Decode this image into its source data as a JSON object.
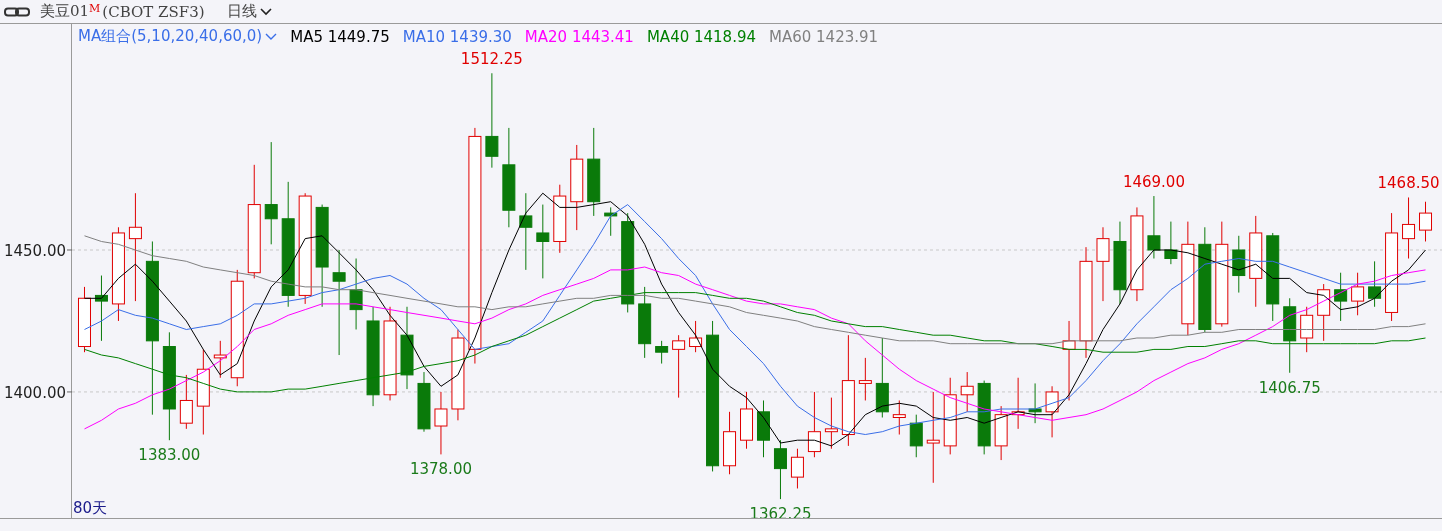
{
  "header": {
    "badge": "M",
    "code": "(CBOT ZSF3)",
    "period": "日线"
  },
  "legend": {
    "title": "MA组合(5,10,20,40,60,0)",
    "items": [
      {
        "value": "1449.75"
      },
      {
        "value": "1439.30"
      },
      {
        "value": "1443.41"
      },
      {
        "value": "1418.94"
      },
      {
        "value": "1423.91"
      }
    ]
  },
  "chart_data": {
    "type": "candlestick",
    "ylim": [
      1355.6,
      1529.6
    ],
    "yticks": [
      {
        "value": 1450,
        "label": "1450.00"
      },
      {
        "value": 1400,
        "label": "1400.00"
      }
    ],
    "series": [
      {
        "name": "美豆01",
        "ohlc": [
          [
            1416,
            1437,
            1414,
            1433
          ],
          [
            1434,
            1441,
            1418,
            1432
          ],
          [
            1431,
            1458,
            1425,
            1456
          ],
          [
            1454,
            1470,
            1432,
            1458
          ],
          [
            1446,
            1453,
            1392,
            1418
          ],
          [
            1416,
            1421,
            1383,
            1394
          ],
          [
            1389,
            1406,
            1387,
            1397
          ],
          [
            1395,
            1415,
            1385,
            1408
          ],
          [
            1412,
            1418,
            1405,
            1413
          ],
          [
            1405,
            1443,
            1402,
            1439
          ],
          [
            1442,
            1480,
            1440,
            1466
          ],
          [
            1466,
            1488,
            1452,
            1461
          ],
          [
            1461,
            1474,
            1430,
            1434
          ],
          [
            1434,
            1470,
            1431,
            1469
          ],
          [
            1465,
            1466,
            1430,
            1444
          ],
          [
            1442,
            1450,
            1413,
            1439
          ],
          [
            1436,
            1447,
            1422,
            1429
          ],
          [
            1425,
            1430,
            1395,
            1399
          ],
          [
            1399,
            1430,
            1397,
            1425
          ],
          [
            1420,
            1430,
            1401,
            1406
          ],
          [
            1403,
            1407,
            1386,
            1387
          ],
          [
            1388,
            1400,
            1378,
            1394
          ],
          [
            1394,
            1422,
            1390,
            1419
          ],
          [
            1415,
            1493,
            1410,
            1490
          ],
          [
            1490,
            1512.25,
            1479,
            1483
          ],
          [
            1480,
            1493,
            1458,
            1464
          ],
          [
            1462,
            1470,
            1443,
            1458
          ],
          [
            1456,
            1466,
            1440,
            1453
          ],
          [
            1453,
            1473,
            1449,
            1469
          ],
          [
            1467,
            1487,
            1457,
            1482
          ],
          [
            1482,
            1493,
            1462,
            1467
          ],
          [
            1463,
            1465,
            1455,
            1462
          ],
          [
            1460,
            1463,
            1428,
            1431
          ],
          [
            1431,
            1437,
            1412,
            1417
          ],
          [
            1416,
            1418,
            1410,
            1414
          ],
          [
            1415,
            1420,
            1398,
            1418
          ],
          [
            1416,
            1425,
            1414,
            1419
          ],
          [
            1420,
            1425,
            1372,
            1374
          ],
          [
            1374,
            1393,
            1371,
            1386
          ],
          [
            1383,
            1400,
            1380,
            1394
          ],
          [
            1393,
            1397,
            1377,
            1383
          ],
          [
            1380,
            1383,
            1362.25,
            1373
          ],
          [
            1370,
            1380,
            1366,
            1377
          ],
          [
            1379,
            1400,
            1377,
            1386
          ],
          [
            1386,
            1398,
            1380,
            1387
          ],
          [
            1385,
            1420,
            1381,
            1404
          ],
          [
            1403,
            1412,
            1397,
            1404
          ],
          [
            1403,
            1419,
            1391,
            1393
          ],
          [
            1391,
            1397,
            1385,
            1392
          ],
          [
            1389,
            1392,
            1377,
            1381
          ],
          [
            1382,
            1400,
            1368,
            1383
          ],
          [
            1381,
            1405,
            1378,
            1399
          ],
          [
            1399,
            1407,
            1393,
            1402
          ],
          [
            1403,
            1404,
            1378,
            1381
          ],
          [
            1381,
            1395,
            1376,
            1392
          ],
          [
            1392,
            1405,
            1387,
            1393
          ],
          [
            1394,
            1403,
            1389,
            1393
          ],
          [
            1393,
            1402,
            1384,
            1400
          ],
          [
            1415,
            1425,
            1397,
            1418
          ],
          [
            1418,
            1451,
            1412,
            1446
          ],
          [
            1446,
            1458,
            1432,
            1454
          ],
          [
            1453,
            1460,
            1431,
            1436
          ],
          [
            1436,
            1465,
            1432,
            1462
          ],
          [
            1455,
            1469,
            1447,
            1450
          ],
          [
            1450,
            1460,
            1445,
            1447
          ],
          [
            1424,
            1460,
            1420,
            1452
          ],
          [
            1452,
            1458,
            1421,
            1422
          ],
          [
            1424,
            1460,
            1423,
            1452
          ],
          [
            1450,
            1455,
            1435,
            1441
          ],
          [
            1440,
            1462,
            1430,
            1456
          ],
          [
            1455,
            1456,
            1425,
            1431
          ],
          [
            1430,
            1433,
            1406.75,
            1418
          ],
          [
            1419,
            1430,
            1414,
            1427
          ],
          [
            1427,
            1438,
            1418,
            1436
          ],
          [
            1436,
            1442,
            1425,
            1432
          ],
          [
            1432,
            1442,
            1427,
            1437
          ],
          [
            1437,
            1446,
            1430,
            1433
          ],
          [
            1428,
            1463,
            1425,
            1456
          ],
          [
            1454,
            1468.5,
            1447,
            1459
          ],
          [
            1457,
            1467,
            1453,
            1463
          ]
        ]
      },
      {
        "name": "MA5",
        "type": "line",
        "color": "#000000",
        "values": [
          1433,
          1433,
          1440,
          1445,
          1439,
          1432,
          1425,
          1415,
          1406,
          1410,
          1425,
          1437,
          1443,
          1454,
          1455,
          1449,
          1443,
          1436,
          1427,
          1420,
          1409,
          1402,
          1406,
          1419,
          1435,
          1450,
          1463,
          1470,
          1465,
          1465,
          1466,
          1467,
          1462,
          1452,
          1438,
          1428,
          1420,
          1408,
          1402,
          1398,
          1391,
          1382,
          1383,
          1383,
          1381,
          1385,
          1392,
          1395,
          1396,
          1395,
          1391,
          1390,
          1391,
          1389,
          1391,
          1393,
          1392,
          1392,
          1399,
          1410,
          1422,
          1431,
          1443,
          1450,
          1450,
          1449,
          1447,
          1445,
          1443,
          1445,
          1440,
          1440,
          1435,
          1434,
          1429,
          1430,
          1433,
          1439,
          1443,
          1450
        ]
      },
      {
        "name": "MA10",
        "type": "line",
        "color": "#3a6ee8",
        "values": [
          1422,
          1425,
          1429,
          1427,
          1426,
          1424,
          1422,
          1423,
          1424,
          1427,
          1431,
          1431,
          1432,
          1433,
          1435,
          1436,
          1438,
          1440,
          1441,
          1438,
          1433,
          1429,
          1422,
          1415,
          1416,
          1417,
          1421,
          1425,
          1434,
          1443,
          1452,
          1462,
          1466,
          1460,
          1454,
          1447,
          1441,
          1431,
          1422,
          1416,
          1410,
          1402,
          1395,
          1391,
          1388,
          1386,
          1385,
          1386,
          1388,
          1389,
          1390,
          1391,
          1393,
          1393,
          1394,
          1394,
          1394,
          1396,
          1398,
          1404,
          1411,
          1417,
          1424,
          1430,
          1436,
          1440,
          1445,
          1446,
          1447,
          1446,
          1446,
          1444,
          1442,
          1440,
          1438,
          1438,
          1438,
          1438,
          1438,
          1439
        ]
      },
      {
        "name": "MA20",
        "type": "line",
        "color": "#ff00ff",
        "values": [
          1387,
          1390,
          1394,
          1396,
          1399,
          1401,
          1404,
          1407,
          1411,
          1416,
          1422,
          1424,
          1427,
          1429,
          1431,
          1431,
          1431,
          1430,
          1429,
          1428,
          1427,
          1426,
          1425,
          1424,
          1426,
          1429,
          1431,
          1434,
          1436,
          1438,
          1440,
          1443,
          1443,
          1444,
          1442,
          1441,
          1438,
          1436,
          1434,
          1432,
          1431,
          1431,
          1430,
          1429,
          1426,
          1424,
          1418,
          1413,
          1408,
          1404,
          1401,
          1398,
          1396,
          1394,
          1393,
          1392,
          1391,
          1390,
          1391,
          1392,
          1394,
          1397,
          1400,
          1404,
          1407,
          1410,
          1412,
          1415,
          1417,
          1420,
          1423,
          1427,
          1429,
          1432,
          1435,
          1438,
          1439,
          1441,
          1442,
          1443
        ]
      },
      {
        "name": "MA40",
        "type": "line",
        "color": "#008000",
        "values": [
          1415,
          1413,
          1412,
          1410,
          1408,
          1406,
          1405,
          1403,
          1401,
          1400,
          1400,
          1400,
          1401,
          1401,
          1402,
          1403,
          1404,
          1405,
          1406,
          1407,
          1409,
          1410,
          1411,
          1413,
          1416,
          1418,
          1420,
          1423,
          1426,
          1429,
          1432,
          1433,
          1434,
          1435,
          1435,
          1435,
          1435,
          1434,
          1433,
          1433,
          1432,
          1430,
          1428,
          1427,
          1425,
          1424,
          1423,
          1423,
          1422,
          1421,
          1420,
          1420,
          1419,
          1418,
          1418,
          1417,
          1417,
          1416,
          1415,
          1415,
          1414,
          1414,
          1414,
          1415,
          1415,
          1416,
          1416,
          1417,
          1418,
          1418,
          1417,
          1417,
          1417,
          1417,
          1417,
          1417,
          1417,
          1418,
          1418,
          1419
        ]
      },
      {
        "name": "MA60",
        "type": "line",
        "color": "#808080",
        "values": [
          1455,
          1453,
          1452,
          1450,
          1448,
          1447,
          1446,
          1444,
          1443,
          1442,
          1441,
          1439,
          1438,
          1437,
          1437,
          1436,
          1436,
          1435,
          1434,
          1433,
          1432,
          1431,
          1430,
          1430,
          1429,
          1430,
          1430,
          1431,
          1432,
          1433,
          1433,
          1434,
          1434,
          1434,
          1433,
          1433,
          1432,
          1431,
          1430,
          1428,
          1427,
          1426,
          1425,
          1423,
          1422,
          1421,
          1420,
          1419,
          1418,
          1418,
          1418,
          1417,
          1417,
          1417,
          1417,
          1417,
          1417,
          1417,
          1418,
          1418,
          1418,
          1418,
          1419,
          1419,
          1420,
          1420,
          1421,
          1421,
          1422,
          1422,
          1422,
          1422,
          1422,
          1422,
          1422,
          1422,
          1422,
          1423,
          1423,
          1424
        ]
      }
    ],
    "annotations": [
      "1512.25",
      "1383.00",
      "1378.00",
      "1362.25",
      "1469.00",
      "1406.75",
      "1468.50"
    ]
  },
  "range_label": "80天"
}
